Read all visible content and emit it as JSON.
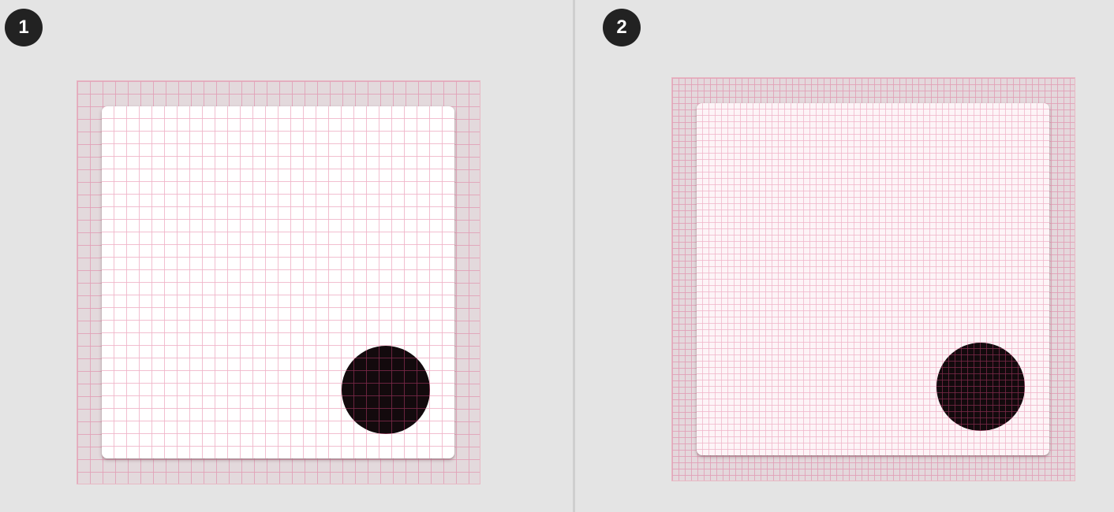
{
  "panels": [
    {
      "step_label": "1",
      "grid": "coarse"
    },
    {
      "step_label": "2",
      "grid": "fine"
    }
  ],
  "colors": {
    "background": "#e4e4e4",
    "badge": "#222222",
    "grid_line": "#e2a0b6",
    "card": "#ffffff",
    "fab": "#130a0d"
  }
}
